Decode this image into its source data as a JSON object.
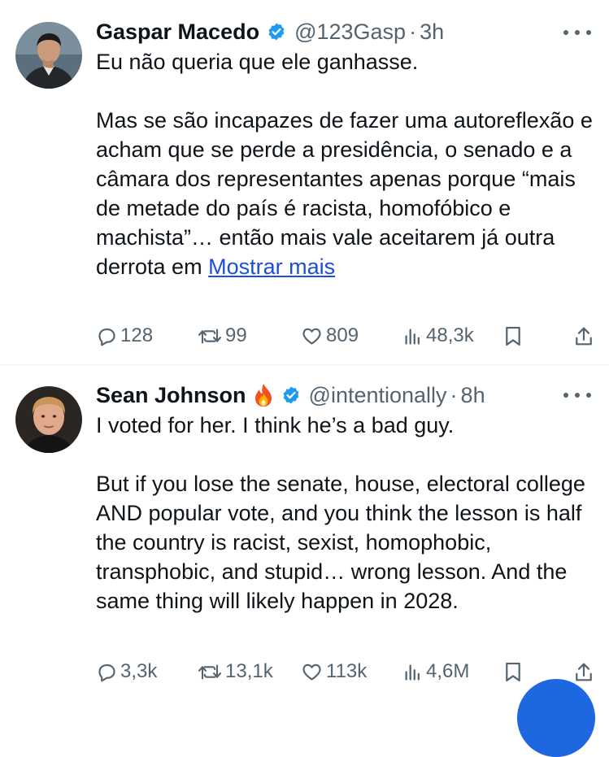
{
  "tweets": [
    {
      "author_name": "Gaspar Macedo",
      "handle": "@123Gasp",
      "separator": "·",
      "time": "3h",
      "verified": true,
      "emoji": "",
      "text": {
        "line1": "Eu não queria que ele ganhasse.",
        "paragraph2": "Mas se são incapazes de fazer uma autoreflexão e acham que se perde a presidência, o senado e a câmara dos representantes  apenas porque “mais de metade do país é racista, homofóbico e machista”… então mais vale aceitarem já outra derrota em",
        "show_more": "Mostrar mais"
      },
      "stats": {
        "replies": "128",
        "reposts": "99",
        "likes": "809",
        "views": "48,3k"
      }
    },
    {
      "author_name": "Sean Johnson",
      "handle": "@intentionally",
      "separator": "·",
      "time": "8h",
      "verified": true,
      "emoji": "fire-emoji",
      "text": {
        "line1": "I voted for her. I think he’s a bad guy.",
        "paragraph2": "But if you lose the senate, house, electoral college AND popular vote, and you think the lesson is half the country is racist, sexist, homophobic, transphobic, and stupid… wrong lesson. And the same thing will likely happen in 2028."
      },
      "stats": {
        "replies": "3,3k",
        "reposts": "13,1k",
        "likes": "113k",
        "views": "4,6M"
      }
    }
  ],
  "colors": {
    "text": "#0f1419",
    "muted": "#536471",
    "verified": "#1d9bf0",
    "link": "#1d4ed8",
    "divider": "#eff3f4",
    "fab": "#1d68e0"
  },
  "icons": [
    "more-icon",
    "verified-badge-icon",
    "reply-icon",
    "repost-icon",
    "like-icon",
    "views-icon",
    "bookmark-icon",
    "share-icon"
  ]
}
